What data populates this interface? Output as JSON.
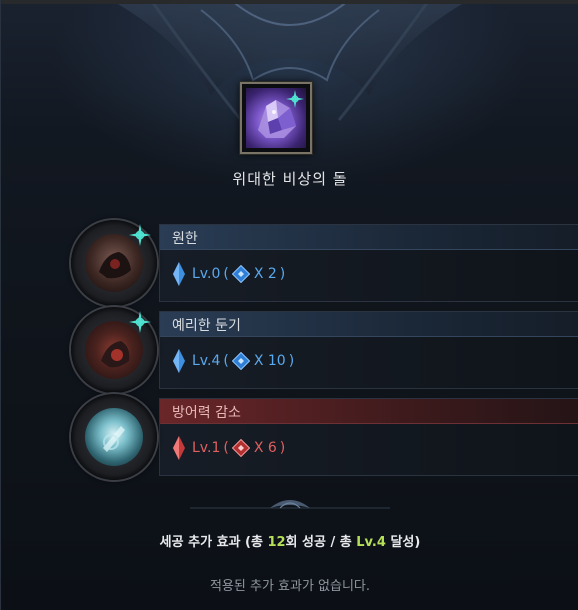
{
  "stone": {
    "title": "위대한 비상의 돌",
    "icon": "ability-stone-icon"
  },
  "engravings": [
    {
      "name": "원한",
      "level_text": "Lv.0",
      "multiplier": "X 2",
      "type": "buff",
      "accent": "#5aa9ee",
      "icon": "grudge-engraving-icon"
    },
    {
      "name": "예리한 둔기",
      "level_text": "Lv.4",
      "multiplier": "X 10",
      "type": "buff",
      "accent": "#5aa9ee",
      "icon": "keen-blunt-weapon-engraving-icon"
    },
    {
      "name": "방어력 감소",
      "level_text": "Lv.1",
      "multiplier": "X 6",
      "type": "debuff",
      "accent": "#e06060",
      "icon": "defense-reduction-engraving-icon"
    }
  ],
  "summary": {
    "prefix": "세공 추가 효과 (총 ",
    "success_count": "12",
    "middle": "회 성공 / 총 ",
    "level": "Lv.4",
    "suffix": " 달성)"
  },
  "no_effect_text": "적용된 추가 효과가 없습니다."
}
